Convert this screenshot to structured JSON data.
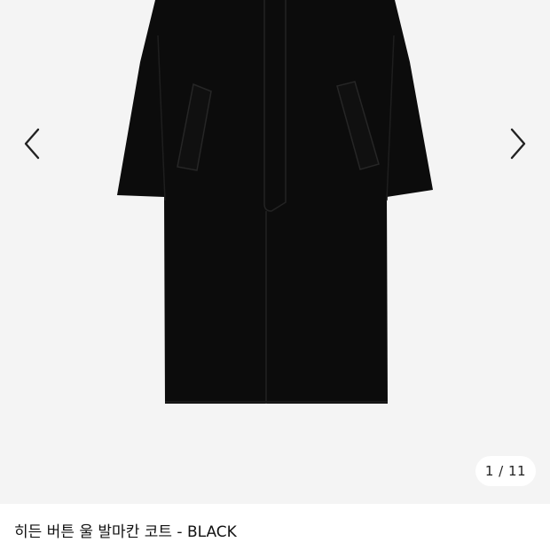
{
  "gallery": {
    "image_alt": "black coat",
    "counter": {
      "current": "1",
      "separator": "/",
      "total": "11",
      "text": "1 / 11"
    },
    "prev_icon": "chevron-left-icon",
    "next_icon": "chevron-right-icon"
  },
  "product": {
    "title": "히든 버튼 울 발마칸 코트 - BLACK"
  },
  "colors": {
    "gallery_bg": "#f4f4f4",
    "coat": "#0c0c0c",
    "arrow": "#222222",
    "counter_bg": "#ffffff",
    "text": "#111111"
  }
}
